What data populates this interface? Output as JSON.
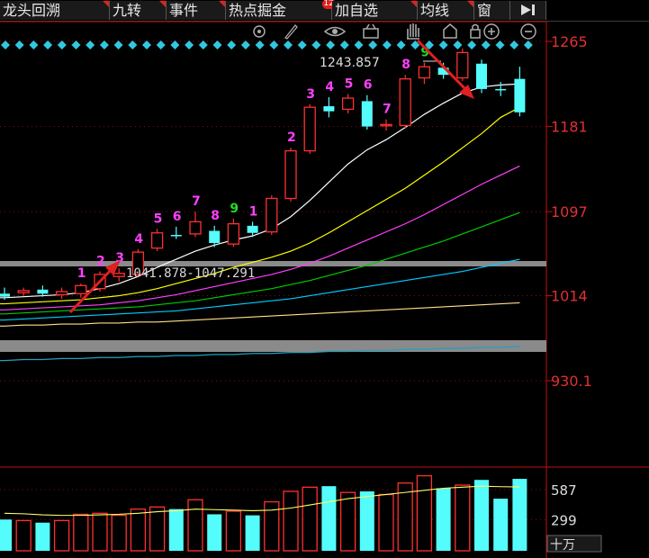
{
  "tabs": [
    {
      "label": "龙头回溯",
      "badge": ""
    },
    {
      "label": "九转",
      "badge": ""
    },
    {
      "label": "事件",
      "badge": ""
    },
    {
      "label": "热点掘金",
      "badge": "12"
    },
    {
      "label": "加自选",
      "badge": ""
    },
    {
      "label": "均线",
      "badge": ""
    },
    {
      "label": "窗",
      "badge": ""
    }
  ],
  "toolbar_icons": [
    "gear-icon",
    "pen-icon",
    "eye-icon",
    "basket-icon",
    "hand-icon",
    "home-icon",
    "lock-icon",
    "zoom-in-icon",
    "zoom-out-icon"
  ],
  "chart_data": {
    "type": "candlestick",
    "price_axis": {
      "ticks": [
        "1265",
        "1181",
        "1097",
        "1014",
        "930.1"
      ],
      "ylim": [
        900,
        1290
      ]
    },
    "volume_axis": {
      "ticks": [
        "587",
        "299"
      ],
      "unit": "十万",
      "ylim": [
        0,
        800
      ]
    },
    "annotations": {
      "high_label": "1243.857",
      "zone_label": "1041.878-1047.291"
    },
    "candles": [
      {
        "o": 1016,
        "h": 1022,
        "l": 1010,
        "c": 1013,
        "v": 300,
        "nine": ""
      },
      {
        "o": 1017,
        "h": 1022,
        "l": 1014,
        "c": 1019,
        "v": 290,
        "nine": ""
      },
      {
        "o": 1020,
        "h": 1024,
        "l": 1013,
        "c": 1016,
        "v": 270,
        "nine": ""
      },
      {
        "o": 1015,
        "h": 1022,
        "l": 1011,
        "c": 1018,
        "v": 290,
        "nine": ""
      },
      {
        "o": 1016,
        "h": 1026,
        "l": 1012,
        "c": 1024,
        "v": 350,
        "nine": "1"
      },
      {
        "o": 1021,
        "h": 1038,
        "l": 1018,
        "c": 1035,
        "v": 360,
        "nine": "2"
      },
      {
        "o": 1033,
        "h": 1041,
        "l": 1028,
        "c": 1036,
        "v": 340,
        "nine": "3"
      },
      {
        "o": 1035,
        "h": 1060,
        "l": 1032,
        "c": 1057,
        "v": 400,
        "nine": "4"
      },
      {
        "o": 1061,
        "h": 1080,
        "l": 1058,
        "c": 1076,
        "v": 420,
        "nine": "5"
      },
      {
        "o": 1074,
        "h": 1082,
        "l": 1070,
        "c": 1073,
        "v": 400,
        "nine": "6"
      },
      {
        "o": 1075,
        "h": 1097,
        "l": 1072,
        "c": 1087,
        "v": 490,
        "nine": "7"
      },
      {
        "o": 1078,
        "h": 1083,
        "l": 1062,
        "c": 1066,
        "v": 350,
        "nine": "8"
      },
      {
        "o": 1065,
        "h": 1090,
        "l": 1062,
        "c": 1085,
        "v": 380,
        "nine": "9"
      },
      {
        "o": 1083,
        "h": 1087,
        "l": 1072,
        "c": 1076,
        "v": 340,
        "nine": "1"
      },
      {
        "o": 1077,
        "h": 1113,
        "l": 1074,
        "c": 1110,
        "v": 470,
        "nine": ""
      },
      {
        "o": 1110,
        "h": 1160,
        "l": 1107,
        "c": 1157,
        "v": 570,
        "nine": "2"
      },
      {
        "o": 1157,
        "h": 1203,
        "l": 1154,
        "c": 1200,
        "v": 610,
        "nine": "3"
      },
      {
        "o": 1201,
        "h": 1210,
        "l": 1190,
        "c": 1196,
        "v": 620,
        "nine": "4"
      },
      {
        "o": 1198,
        "h": 1213,
        "l": 1194,
        "c": 1209,
        "v": 560,
        "nine": "5"
      },
      {
        "o": 1206,
        "h": 1212,
        "l": 1178,
        "c": 1181,
        "v": 570,
        "nine": "6"
      },
      {
        "o": 1182,
        "h": 1188,
        "l": 1177,
        "c": 1183,
        "v": 540,
        "nine": "7"
      },
      {
        "o": 1182,
        "h": 1232,
        "l": 1179,
        "c": 1228,
        "v": 650,
        "nine": "8"
      },
      {
        "o": 1229,
        "h": 1244,
        "l": 1223,
        "c": 1240,
        "v": 720,
        "nine": "9"
      },
      {
        "o": 1239,
        "h": 1244,
        "l": 1228,
        "c": 1232,
        "v": 600,
        "nine": ""
      },
      {
        "o": 1229,
        "h": 1258,
        "l": 1226,
        "c": 1254,
        "v": 630,
        "nine": ""
      },
      {
        "o": 1243,
        "h": 1247,
        "l": 1214,
        "c": 1218,
        "v": 680,
        "nine": ""
      },
      {
        "o": 1218,
        "h": 1225,
        "l": 1211,
        "c": 1217,
        "v": 500,
        "nine": ""
      },
      {
        "o": 1228,
        "h": 1240,
        "l": 1191,
        "c": 1195,
        "v": 690,
        "nine": ""
      }
    ],
    "ma_lines": [
      {
        "color": "#ffffff",
        "values": [
          1012,
          1013,
          1014,
          1015,
          1017,
          1021,
          1026,
          1033,
          1042,
          1050,
          1058,
          1064,
          1069,
          1073,
          1080,
          1092,
          1108,
          1126,
          1144,
          1158,
          1168,
          1180,
          1193,
          1204,
          1214,
          1220,
          1222,
          1223
        ]
      },
      {
        "color": "#ffff00",
        "values": [
          1006,
          1007,
          1008,
          1009,
          1010,
          1012,
          1014,
          1017,
          1021,
          1026,
          1031,
          1036,
          1042,
          1047,
          1052,
          1058,
          1066,
          1076,
          1087,
          1098,
          1109,
          1120,
          1133,
          1146,
          1160,
          1174,
          1190,
          1200
        ]
      },
      {
        "color": "#ff40ff",
        "values": [
          1000,
          1001,
          1002,
          1003,
          1004,
          1005,
          1007,
          1009,
          1012,
          1015,
          1019,
          1023,
          1027,
          1031,
          1035,
          1040,
          1046,
          1053,
          1061,
          1069,
          1077,
          1085,
          1094,
          1104,
          1114,
          1124,
          1133,
          1142
        ]
      },
      {
        "color": "#00cc00",
        "values": [
          996,
          997,
          998,
          999,
          1000,
          1001,
          1002,
          1003,
          1005,
          1007,
          1009,
          1012,
          1015,
          1018,
          1021,
          1025,
          1029,
          1034,
          1039,
          1044,
          1050,
          1056,
          1062,
          1068,
          1075,
          1082,
          1089,
          1096
        ]
      },
      {
        "color": "#00ccff",
        "values": [
          990,
          991,
          992,
          993,
          994,
          995,
          996,
          997,
          998,
          999,
          1001,
          1003,
          1005,
          1007,
          1009,
          1011,
          1014,
          1017,
          1020,
          1023,
          1026,
          1029,
          1032,
          1035,
          1038,
          1042,
          1046,
          1050
        ]
      },
      {
        "color": "#ffe08a",
        "values": [
          984,
          985,
          985,
          986,
          986,
          987,
          987,
          988,
          988,
          989,
          990,
          991,
          992,
          993,
          994,
          995,
          996,
          997,
          998,
          999,
          1000,
          1001,
          1002,
          1003,
          1004,
          1005,
          1006,
          1007
        ]
      },
      {
        "color": "#22a0c0",
        "values": [
          950,
          951,
          951,
          952,
          952,
          953,
          953,
          954,
          954,
          955,
          955,
          956,
          956,
          957,
          957,
          958,
          958,
          959,
          959,
          960,
          960,
          961,
          961,
          962,
          962,
          963,
          963,
          964
        ]
      }
    ],
    "volume_ma": [
      360,
      355,
      345,
      340,
      340,
      345,
      350,
      360,
      375,
      385,
      400,
      395,
      390,
      385,
      390,
      410,
      440,
      470,
      500,
      520,
      540,
      560,
      580,
      600,
      610,
      620,
      615,
      612
    ]
  }
}
